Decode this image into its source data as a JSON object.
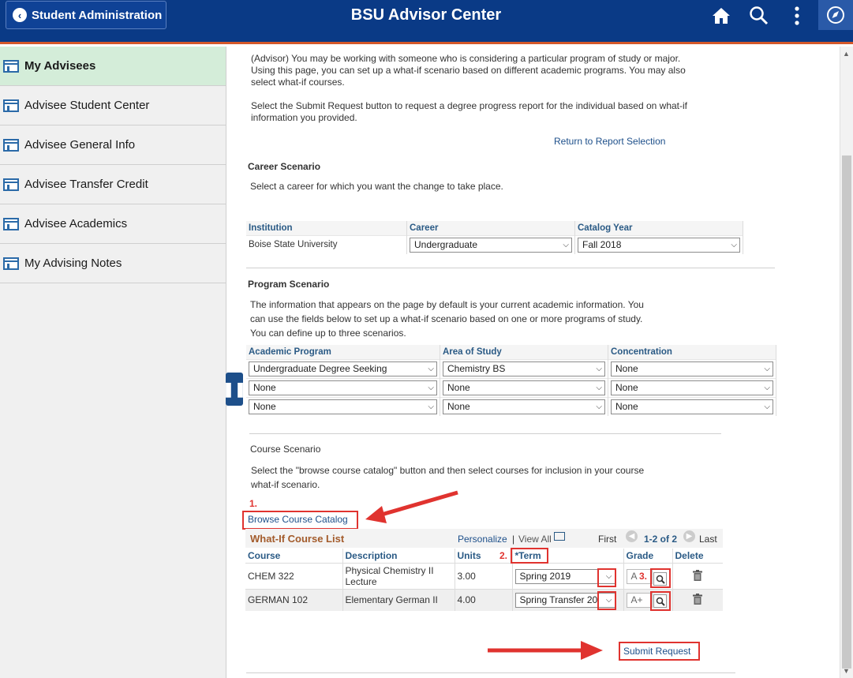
{
  "header": {
    "back_label": "Student Administration",
    "title": "BSU Advisor Center"
  },
  "sidebar": {
    "items": [
      {
        "label": "My Advisees"
      },
      {
        "label": "Advisee Student Center"
      },
      {
        "label": "Advisee General Info"
      },
      {
        "label": "Advisee Transfer Credit"
      },
      {
        "label": "Advisee Academics"
      },
      {
        "label": "My Advising Notes"
      }
    ]
  },
  "intro": {
    "para1_l1": "(Advisor) You may be working with someone who is considering a particular program of study or major.",
    "para1_l2": "Using this page, you can set up a what-if scenario based on different academic programs. You may also",
    "para1_l3": "select what-if courses.",
    "para2_l1": "Select the Submit Request button to request a degree progress report for the individual based on what-if",
    "para2_l2": "information you provided.",
    "return_link": "Return to Report Selection"
  },
  "career": {
    "title": "Career Scenario",
    "desc": "Select a career for which you want the change to take place.",
    "headers": [
      "Institution",
      "Career",
      "Catalog Year"
    ],
    "institution": "Boise State University",
    "career_value": "Undergraduate",
    "catalog_year": "Fall 2018"
  },
  "program": {
    "title": "Program Scenario",
    "desc_l1": "The information that appears on the page by default is your current academic information. You",
    "desc_l2": "can use the fields below to set up a what-if scenario based on one or more programs of study.",
    "desc_l3": "You can define up to three scenarios.",
    "headers": [
      "Academic Program",
      "Area of Study",
      "Concentration"
    ],
    "rows": [
      [
        "Undergraduate Degree Seeking",
        "Chemistry BS",
        "None"
      ],
      [
        "None",
        "None",
        "None"
      ],
      [
        "None",
        "None",
        "None"
      ]
    ]
  },
  "course": {
    "title": "Course Scenario",
    "desc_l1": "Select the \"browse course catalog\" button and then select courses for inclusion in your course",
    "desc_l2": "what-if scenario.",
    "browse_label": "Browse Course Catalog",
    "list_title": "What-If Course List",
    "personalize": "Personalize",
    "sep": "|",
    "view_all": "View All",
    "first": "First",
    "range": "1-2 of 2",
    "last": "Last",
    "headers": [
      "Course",
      "Description",
      "Units",
      "*Term",
      "Grade",
      "Delete"
    ],
    "rows": [
      {
        "course": "CHEM  322",
        "desc_l1": "Physical Chemistry II",
        "desc_l2": "Lecture",
        "units": "3.00",
        "term": "Spring 2019",
        "grade": "A"
      },
      {
        "course": "GERMAN  102",
        "desc_l1": "Elementary German II",
        "desc_l2": "",
        "units": "4.00",
        "term": "Spring Transfer 20",
        "grade": "A+"
      }
    ],
    "submit_label": "Submit Request"
  },
  "annotations": {
    "step1": "1.",
    "step2": "2.",
    "step3": "3.",
    "color": "#e0332f"
  }
}
